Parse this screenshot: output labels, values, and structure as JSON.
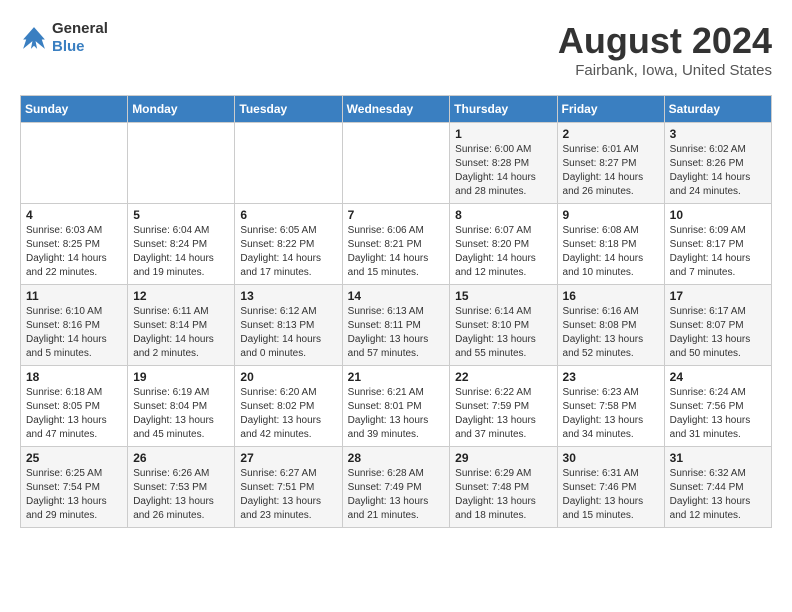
{
  "logo": {
    "general": "General",
    "blue": "Blue"
  },
  "title": "August 2024",
  "subtitle": "Fairbank, Iowa, United States",
  "days_of_week": [
    "Sunday",
    "Monday",
    "Tuesday",
    "Wednesday",
    "Thursday",
    "Friday",
    "Saturday"
  ],
  "weeks": [
    [
      {
        "day": "",
        "sunrise": "",
        "sunset": "",
        "daylight": ""
      },
      {
        "day": "",
        "sunrise": "",
        "sunset": "",
        "daylight": ""
      },
      {
        "day": "",
        "sunrise": "",
        "sunset": "",
        "daylight": ""
      },
      {
        "day": "",
        "sunrise": "",
        "sunset": "",
        "daylight": ""
      },
      {
        "day": "1",
        "sunrise": "Sunrise: 6:00 AM",
        "sunset": "Sunset: 8:28 PM",
        "daylight": "Daylight: 14 hours and 28 minutes."
      },
      {
        "day": "2",
        "sunrise": "Sunrise: 6:01 AM",
        "sunset": "Sunset: 8:27 PM",
        "daylight": "Daylight: 14 hours and 26 minutes."
      },
      {
        "day": "3",
        "sunrise": "Sunrise: 6:02 AM",
        "sunset": "Sunset: 8:26 PM",
        "daylight": "Daylight: 14 hours and 24 minutes."
      }
    ],
    [
      {
        "day": "4",
        "sunrise": "Sunrise: 6:03 AM",
        "sunset": "Sunset: 8:25 PM",
        "daylight": "Daylight: 14 hours and 22 minutes."
      },
      {
        "day": "5",
        "sunrise": "Sunrise: 6:04 AM",
        "sunset": "Sunset: 8:24 PM",
        "daylight": "Daylight: 14 hours and 19 minutes."
      },
      {
        "day": "6",
        "sunrise": "Sunrise: 6:05 AM",
        "sunset": "Sunset: 8:22 PM",
        "daylight": "Daylight: 14 hours and 17 minutes."
      },
      {
        "day": "7",
        "sunrise": "Sunrise: 6:06 AM",
        "sunset": "Sunset: 8:21 PM",
        "daylight": "Daylight: 14 hours and 15 minutes."
      },
      {
        "day": "8",
        "sunrise": "Sunrise: 6:07 AM",
        "sunset": "Sunset: 8:20 PM",
        "daylight": "Daylight: 14 hours and 12 minutes."
      },
      {
        "day": "9",
        "sunrise": "Sunrise: 6:08 AM",
        "sunset": "Sunset: 8:18 PM",
        "daylight": "Daylight: 14 hours and 10 minutes."
      },
      {
        "day": "10",
        "sunrise": "Sunrise: 6:09 AM",
        "sunset": "Sunset: 8:17 PM",
        "daylight": "Daylight: 14 hours and 7 minutes."
      }
    ],
    [
      {
        "day": "11",
        "sunrise": "Sunrise: 6:10 AM",
        "sunset": "Sunset: 8:16 PM",
        "daylight": "Daylight: 14 hours and 5 minutes."
      },
      {
        "day": "12",
        "sunrise": "Sunrise: 6:11 AM",
        "sunset": "Sunset: 8:14 PM",
        "daylight": "Daylight: 14 hours and 2 minutes."
      },
      {
        "day": "13",
        "sunrise": "Sunrise: 6:12 AM",
        "sunset": "Sunset: 8:13 PM",
        "daylight": "Daylight: 14 hours and 0 minutes."
      },
      {
        "day": "14",
        "sunrise": "Sunrise: 6:13 AM",
        "sunset": "Sunset: 8:11 PM",
        "daylight": "Daylight: 13 hours and 57 minutes."
      },
      {
        "day": "15",
        "sunrise": "Sunrise: 6:14 AM",
        "sunset": "Sunset: 8:10 PM",
        "daylight": "Daylight: 13 hours and 55 minutes."
      },
      {
        "day": "16",
        "sunrise": "Sunrise: 6:16 AM",
        "sunset": "Sunset: 8:08 PM",
        "daylight": "Daylight: 13 hours and 52 minutes."
      },
      {
        "day": "17",
        "sunrise": "Sunrise: 6:17 AM",
        "sunset": "Sunset: 8:07 PM",
        "daylight": "Daylight: 13 hours and 50 minutes."
      }
    ],
    [
      {
        "day": "18",
        "sunrise": "Sunrise: 6:18 AM",
        "sunset": "Sunset: 8:05 PM",
        "daylight": "Daylight: 13 hours and 47 minutes."
      },
      {
        "day": "19",
        "sunrise": "Sunrise: 6:19 AM",
        "sunset": "Sunset: 8:04 PM",
        "daylight": "Daylight: 13 hours and 45 minutes."
      },
      {
        "day": "20",
        "sunrise": "Sunrise: 6:20 AM",
        "sunset": "Sunset: 8:02 PM",
        "daylight": "Daylight: 13 hours and 42 minutes."
      },
      {
        "day": "21",
        "sunrise": "Sunrise: 6:21 AM",
        "sunset": "Sunset: 8:01 PM",
        "daylight": "Daylight: 13 hours and 39 minutes."
      },
      {
        "day": "22",
        "sunrise": "Sunrise: 6:22 AM",
        "sunset": "Sunset: 7:59 PM",
        "daylight": "Daylight: 13 hours and 37 minutes."
      },
      {
        "day": "23",
        "sunrise": "Sunrise: 6:23 AM",
        "sunset": "Sunset: 7:58 PM",
        "daylight": "Daylight: 13 hours and 34 minutes."
      },
      {
        "day": "24",
        "sunrise": "Sunrise: 6:24 AM",
        "sunset": "Sunset: 7:56 PM",
        "daylight": "Daylight: 13 hours and 31 minutes."
      }
    ],
    [
      {
        "day": "25",
        "sunrise": "Sunrise: 6:25 AM",
        "sunset": "Sunset: 7:54 PM",
        "daylight": "Daylight: 13 hours and 29 minutes."
      },
      {
        "day": "26",
        "sunrise": "Sunrise: 6:26 AM",
        "sunset": "Sunset: 7:53 PM",
        "daylight": "Daylight: 13 hours and 26 minutes."
      },
      {
        "day": "27",
        "sunrise": "Sunrise: 6:27 AM",
        "sunset": "Sunset: 7:51 PM",
        "daylight": "Daylight: 13 hours and 23 minutes."
      },
      {
        "day": "28",
        "sunrise": "Sunrise: 6:28 AM",
        "sunset": "Sunset: 7:49 PM",
        "daylight": "Daylight: 13 hours and 21 minutes."
      },
      {
        "day": "29",
        "sunrise": "Sunrise: 6:29 AM",
        "sunset": "Sunset: 7:48 PM",
        "daylight": "Daylight: 13 hours and 18 minutes."
      },
      {
        "day": "30",
        "sunrise": "Sunrise: 6:31 AM",
        "sunset": "Sunset: 7:46 PM",
        "daylight": "Daylight: 13 hours and 15 minutes."
      },
      {
        "day": "31",
        "sunrise": "Sunrise: 6:32 AM",
        "sunset": "Sunset: 7:44 PM",
        "daylight": "Daylight: 13 hours and 12 minutes."
      }
    ]
  ]
}
